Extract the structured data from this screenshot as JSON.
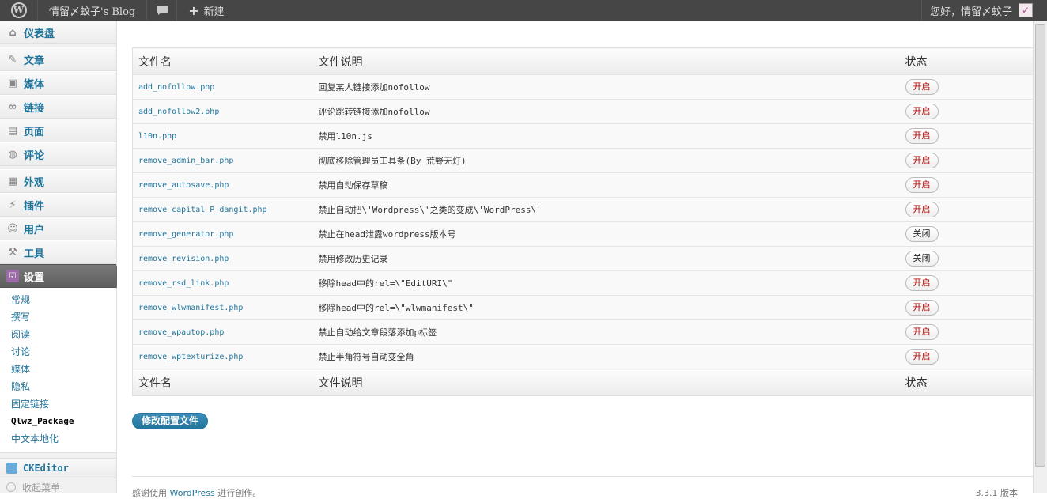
{
  "adminbar": {
    "logo": "W",
    "site_name": "情留〆蚊子's Blog",
    "new_label": "新建",
    "greeting": "您好，情留〆蚊子"
  },
  "sidebar": {
    "dashboard": "仪表盘",
    "posts": "文章",
    "media": "媒体",
    "links": "链接",
    "pages": "页面",
    "comments": "评论",
    "appearance": "外观",
    "plugins": "插件",
    "users": "用户",
    "tools": "工具",
    "settings": "设置",
    "submenu": [
      "常规",
      "撰写",
      "阅读",
      "讨论",
      "媒体",
      "隐私",
      "固定链接",
      "Qlwz_Package",
      "中文本地化"
    ],
    "ckeditor": "CKEditor",
    "collapse": "收起菜单"
  },
  "table": {
    "col_file": "文件名",
    "col_desc": "文件说明",
    "col_status": "状态",
    "rows": [
      {
        "file": "add_nofollow.php",
        "desc": "回复某人链接添加nofollow",
        "status": "开启"
      },
      {
        "file": "add_nofollow2.php",
        "desc": "评论跳转链接添加nofollow",
        "status": "开启"
      },
      {
        "file": "l10n.php",
        "desc": "禁用l10n.js",
        "status": "开启"
      },
      {
        "file": "remove_admin_bar.php",
        "desc": "彻底移除管理员工具条(By 荒野无灯)",
        "status": "开启"
      },
      {
        "file": "remove_autosave.php",
        "desc": "禁用自动保存草稿",
        "status": "开启"
      },
      {
        "file": "remove_capital_P_dangit.php",
        "desc": "禁止自动把\\'Wordpress\\'之类的变成\\'WordPress\\'",
        "status": "开启"
      },
      {
        "file": "remove_generator.php",
        "desc": "禁止在head泄露wordpress版本号",
        "status": "关闭"
      },
      {
        "file": "remove_revision.php",
        "desc": "禁用修改历史记录",
        "status": "关闭"
      },
      {
        "file": "remove_rsd_link.php",
        "desc": "移除head中的rel=\\\"EditURI\\\"",
        "status": "开启"
      },
      {
        "file": "remove_wlwmanifest.php",
        "desc": "移除head中的rel=\\\"wlwmanifest\\\"",
        "status": "开启"
      },
      {
        "file": "remove_wpautop.php",
        "desc": "禁止自动给文章段落添加p标签",
        "status": "开启"
      },
      {
        "file": "remove_wptexturize.php",
        "desc": "禁止半角符号自动变全角",
        "status": "开启"
      }
    ]
  },
  "submit_label": "修改配置文件",
  "footer": {
    "thanks_prefix": "感谢使用",
    "wp_link": "WordPress",
    "thanks_suffix": "进行创作。",
    "version": "3.3.1 版本"
  }
}
